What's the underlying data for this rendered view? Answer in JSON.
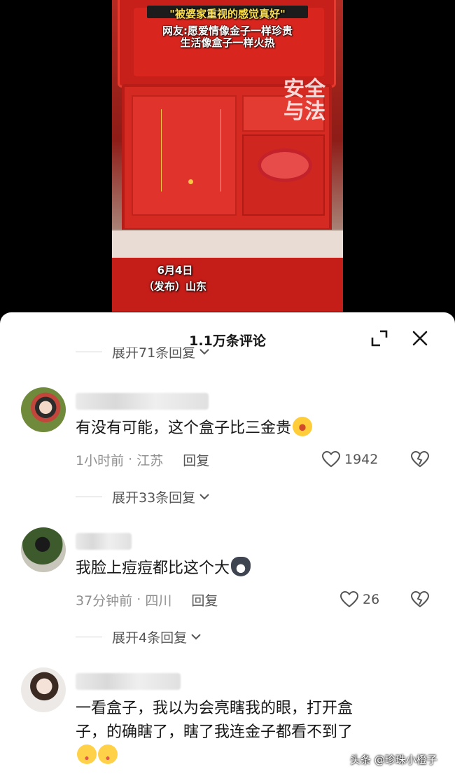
{
  "video": {
    "headline": "\"被婆家重视的感觉真好\"",
    "caption_line1": "网友:愿爱情像金子一样珍贵",
    "caption_line2": "生活像盒子一样火热",
    "watermark_line1": "安全",
    "watermark_line2": "与法",
    "date_line1": "6月4日",
    "date_line2": "（发布）山东"
  },
  "sheet": {
    "title": "1.1万条评论",
    "top_toggle": "展开71条回复"
  },
  "comments": [
    {
      "text": "有没有可能，这个盒子比三金贵",
      "emoji": "laugh-crying-emoji",
      "time": "1小时前",
      "location": "江苏",
      "reply_label": "回复",
      "likes": "1942",
      "toggle": "展开33条回复"
    },
    {
      "text": "我脸上痘痘都比这个大",
      "emoji": "husky-emoji",
      "time": "37分钟前",
      "location": "四川",
      "reply_label": "回复",
      "likes": "26",
      "toggle": "展开4条回复"
    },
    {
      "text_line1": "一看盒子，我以为会亮瞎我的眼，打开盒",
      "text_line2": "子，的确瞎了，瞎了我连金子都看不到了",
      "emoji": "pout-emoji"
    }
  ],
  "footer": {
    "credit": "头条 @珍珠小橙子"
  },
  "colors": {
    "accent_red": "#d42a22",
    "text_primary": "#161616",
    "text_secondary": "#8f8f8f"
  }
}
